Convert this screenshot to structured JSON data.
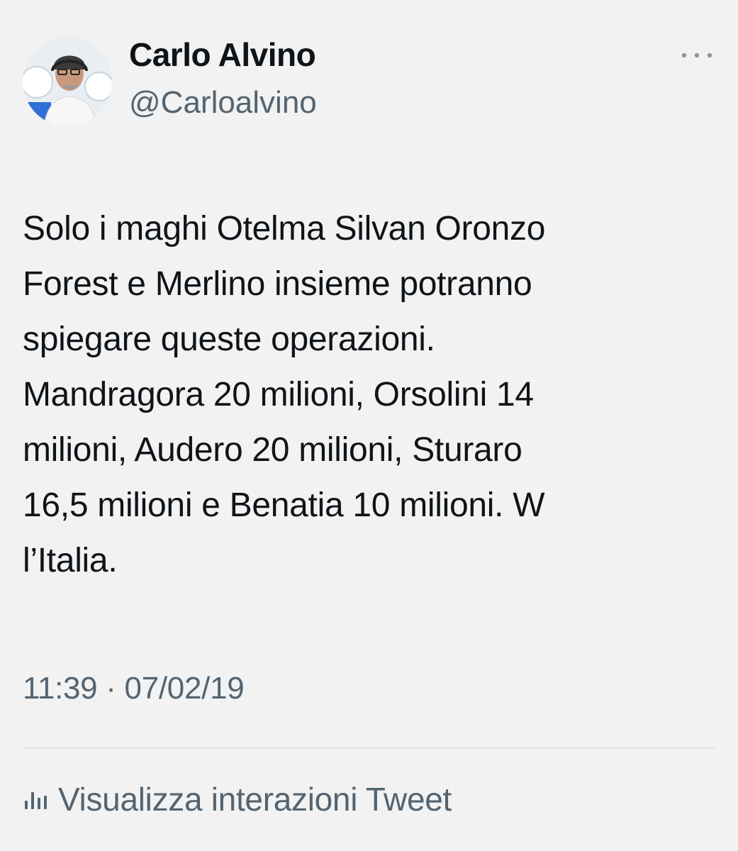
{
  "author": {
    "display_name": "Carlo Alvino",
    "handle": "@Carloalvino",
    "avatar_icon": "profile-photo"
  },
  "tweet": {
    "text": "Solo i maghi Otelma Silvan Oronzo\nForest e Merlino insieme potranno\nspiegare queste operazioni.\nMandragora 20 milioni, Orsolini 14\nmilioni, Audero 20 milioni, Sturaro\n16,5 milioni e Benatia 10 milioni. W\nl’Italia.",
    "timestamp": "11:39 · 07/02/19"
  },
  "actions": {
    "more_icon": "more-horizontal-icon",
    "analytics_label": "Visualizza interazioni Tweet",
    "analytics_icon": "analytics-bars-icon"
  },
  "colors": {
    "background": "#f2f2f2",
    "text_primary": "#0f1419",
    "text_secondary": "#536471",
    "divider": "#cfd9de"
  }
}
